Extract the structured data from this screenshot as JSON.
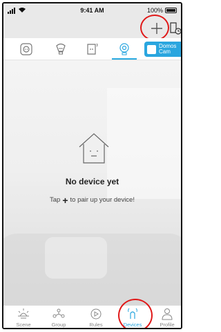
{
  "status_bar": {
    "time": "9:41 AM",
    "battery": "100%"
  },
  "header": {
    "add_icon": "plus-icon",
    "settings_icon": "device-settings-icon"
  },
  "categories": [
    {
      "icon": "round-plug-icon"
    },
    {
      "icon": "bulb-icon"
    },
    {
      "icon": "smart-plug-icon"
    },
    {
      "icon": "camera-icon",
      "selected": true
    },
    {
      "label_line1": "Domos",
      "label_line2": "Cam",
      "icon": "home-icon"
    }
  ],
  "main": {
    "empty_title": "No device yet",
    "hint_prefix": "Tap",
    "hint_suffix": "to pair up your device!"
  },
  "tabs": [
    {
      "label": "Scene",
      "icon": "sun-icon"
    },
    {
      "label": "Group",
      "icon": "group-icon"
    },
    {
      "label": "Rules",
      "icon": "rules-icon"
    },
    {
      "label": "Devices",
      "icon": "devices-icon",
      "active": true
    },
    {
      "label": "Profile",
      "icon": "profile-icon"
    }
  ],
  "colors": {
    "accent": "#2aa6df",
    "highlight": "#e01818"
  }
}
